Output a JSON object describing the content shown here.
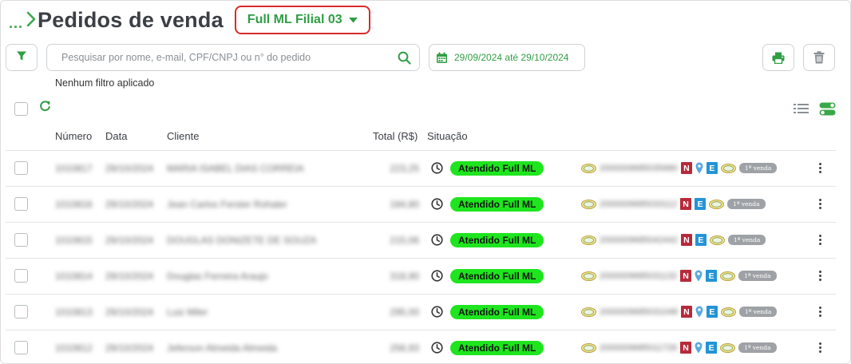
{
  "header": {
    "breadcrumb_dots": "...",
    "title": "Pedidos de venda",
    "store_selector": "Full ML Filial 03"
  },
  "toolbar": {
    "search_placeholder": "Pesquisar por nome, e-mail, CPF/CNPJ ou n° do pedido",
    "date_range": "29/09/2024 até 29/10/2024",
    "filter_note": "Nenhum filtro aplicado"
  },
  "columns": {
    "numero": "Número",
    "data": "Data",
    "cliente": "Cliente",
    "total": "Total (R$)",
    "situacao": "Situação"
  },
  "colors": {
    "accent_green": "#2f9e44",
    "status_green": "#1ee51e",
    "selector_border": "#d92b2b"
  },
  "orders": [
    {
      "numero": "1010817",
      "data": "29/10/2024",
      "cliente": "MARIA ISABEL DIAS CORREIA",
      "total": "223,25",
      "status": "Atendido Full ML",
      "ext_id": "2000009685035680",
      "has_pin": true,
      "tag": "1ª venda"
    },
    {
      "numero": "1010816",
      "data": "29/10/2024",
      "cliente": "Jean Carlos Ferster Rohaler",
      "total": "184,80",
      "status": "Atendido Full ML",
      "ext_id": "2000009685033112",
      "has_pin": false,
      "tag": "1ª venda"
    },
    {
      "numero": "1010815",
      "data": "29/10/2024",
      "cliente": "DOUGLAS DONIZETE DE SOUZA",
      "total": "215,06",
      "status": "Atendido Full ML",
      "ext_id": "2000009685042442",
      "has_pin": false,
      "tag": "1ª venda"
    },
    {
      "numero": "1010814",
      "data": "29/10/2024",
      "cliente": "Douglas Ferreira Araujo",
      "total": "318,90",
      "status": "Atendido Full ML",
      "ext_id": "2000009685031132",
      "has_pin": true,
      "tag": "1ª venda"
    },
    {
      "numero": "1010813",
      "data": "29/10/2024",
      "cliente": "Luiz Miler",
      "total": "295,00",
      "status": "Atendido Full ML",
      "ext_id": "2000009685031048",
      "has_pin": true,
      "tag": "1ª venda"
    },
    {
      "numero": "1010812",
      "data": "29/10/2024",
      "cliente": "Jeferson Almeida Almeida",
      "total": "256,93",
      "status": "Atendido Full ML",
      "ext_id": "2000009685011726",
      "has_pin": true,
      "tag": "1ª venda"
    }
  ]
}
